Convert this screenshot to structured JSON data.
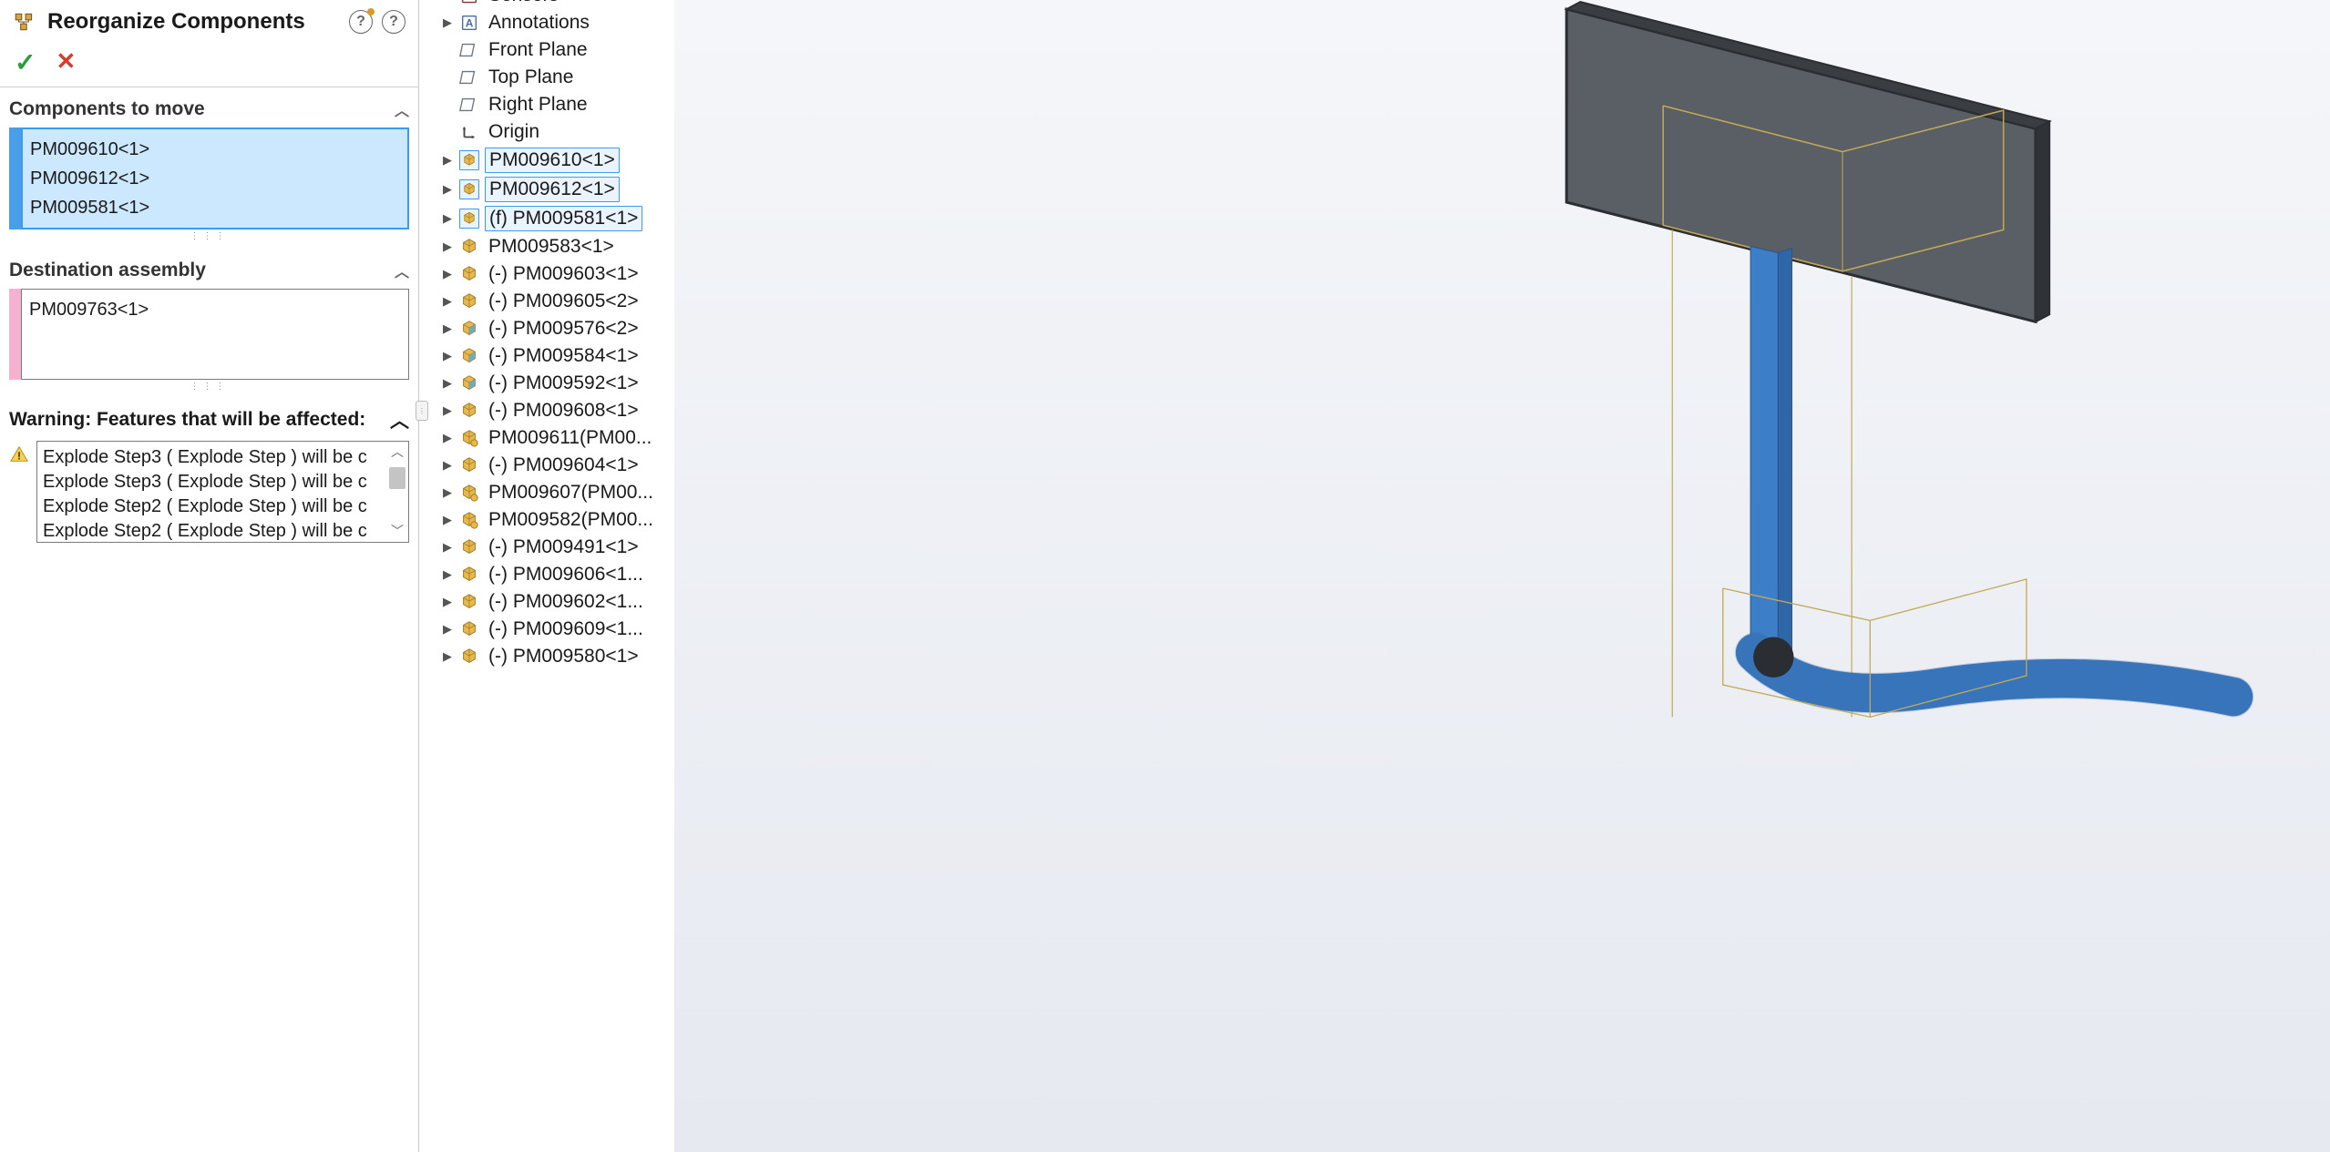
{
  "panel": {
    "title": "Reorganize Components",
    "components_section": "Components to move",
    "destination_section": "Destination assembly",
    "warning_section": "Warning: Features that will be affected:",
    "components_to_move": [
      "PM009610<1>",
      "PM009612<1>",
      "PM009581<1>"
    ],
    "destination": [
      "PM009763<1>"
    ],
    "warnings": [
      "Explode Step3 ( Explode Step )  will be c",
      "Explode Step3 ( Explode Step )  will be c",
      "Explode Step2 ( Explode Step )  will be c",
      "Explode Step2 ( Explode Step )  will be c"
    ]
  },
  "tree": [
    {
      "icon": "sensors",
      "label": "Sensors",
      "expander": false,
      "highlight": false,
      "cut": true
    },
    {
      "icon": "annotations",
      "label": "Annotations",
      "expander": true,
      "highlight": false
    },
    {
      "icon": "plane",
      "label": "Front Plane",
      "expander": false,
      "highlight": false
    },
    {
      "icon": "plane",
      "label": "Top Plane",
      "expander": false,
      "highlight": false
    },
    {
      "icon": "plane",
      "label": "Right Plane",
      "expander": false,
      "highlight": false
    },
    {
      "icon": "origin",
      "label": "Origin",
      "expander": false,
      "highlight": false
    },
    {
      "icon": "subassembly",
      "label": "PM009610<1>",
      "expander": true,
      "highlight": true
    },
    {
      "icon": "subassembly",
      "label": "PM009612<1>",
      "expander": true,
      "highlight": true
    },
    {
      "icon": "subassembly",
      "label": "(f) PM009581<1>",
      "expander": true,
      "highlight": true
    },
    {
      "icon": "subassembly",
      "label": "PM009583<1>",
      "expander": true,
      "highlight": false
    },
    {
      "icon": "subassembly",
      "label": "(-) PM009603<1>",
      "expander": true,
      "highlight": false
    },
    {
      "icon": "subassembly",
      "label": "(-) PM009605<2>",
      "expander": true,
      "highlight": false
    },
    {
      "icon": "part",
      "label": "(-) PM009576<2>",
      "expander": true,
      "highlight": false
    },
    {
      "icon": "part",
      "label": "(-) PM009584<1>",
      "expander": true,
      "highlight": false
    },
    {
      "icon": "part",
      "label": "(-) PM009592<1>",
      "expander": true,
      "highlight": false
    },
    {
      "icon": "subassembly",
      "label": "(-) PM009608<1>",
      "expander": true,
      "highlight": false
    },
    {
      "icon": "subassembly-s",
      "label": "PM009611(PM00...",
      "expander": true,
      "highlight": false
    },
    {
      "icon": "subassembly",
      "label": "(-) PM009604<1>",
      "expander": true,
      "highlight": false
    },
    {
      "icon": "subassembly-s",
      "label": "PM009607(PM00...",
      "expander": true,
      "highlight": false
    },
    {
      "icon": "subassembly-s",
      "label": "PM009582(PM00...",
      "expander": true,
      "highlight": false
    },
    {
      "icon": "subassembly",
      "label": "(-) PM009491<1>",
      "expander": true,
      "highlight": false
    },
    {
      "icon": "subassembly",
      "label": "(-) PM009606<1...",
      "expander": true,
      "highlight": false
    },
    {
      "icon": "subassembly",
      "label": "(-) PM009602<1...",
      "expander": true,
      "highlight": false
    },
    {
      "icon": "subassembly",
      "label": "(-) PM009609<1...",
      "expander": true,
      "highlight": false
    },
    {
      "icon": "subassembly",
      "label": "(-) PM009580<1>",
      "expander": true,
      "highlight": false
    }
  ]
}
